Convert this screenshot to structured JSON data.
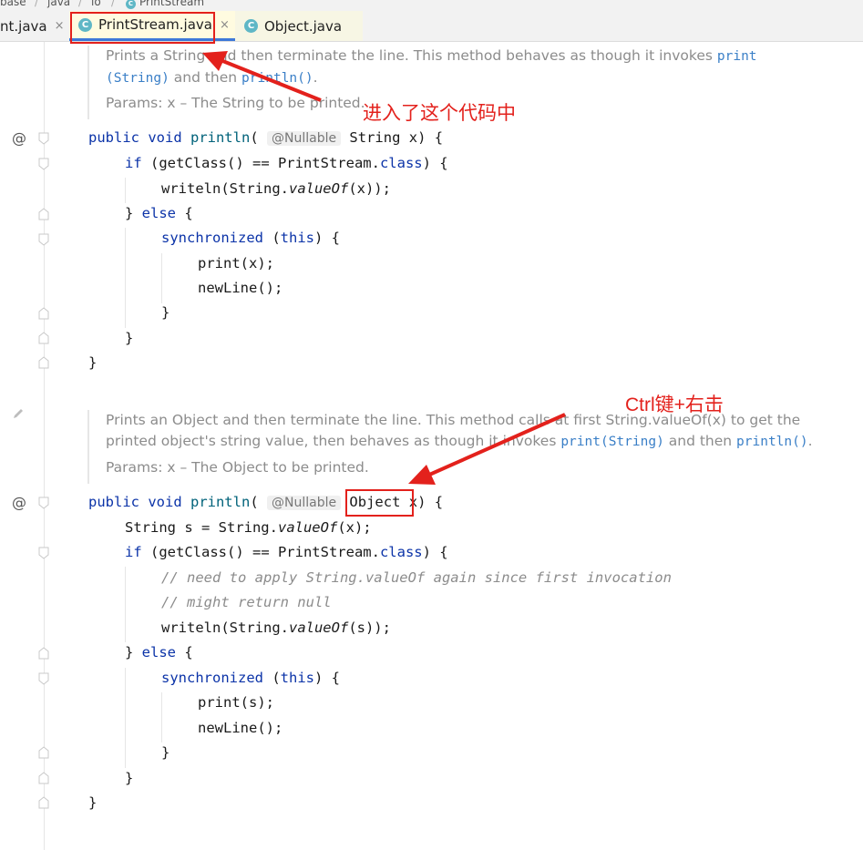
{
  "breadcrumb": {
    "items": [
      "base",
      "java",
      "io",
      "PrintStream"
    ]
  },
  "tabs": [
    {
      "label": "nt.java",
      "close": "×"
    },
    {
      "label": "PrintStream.java",
      "icon": "C",
      "close": "×"
    },
    {
      "label": "Object.java",
      "icon": "C"
    }
  ],
  "doc1": {
    "l1a": "Prints a String and then terminate the line. This method behaves as though it invokes ",
    "l1b": "print",
    "l2a": "(String)",
    "l2b": " and then ",
    "l2c": "println()",
    "l2d": ".",
    "p1": "Params: x – The ",
    "p2": "String",
    "p3": " to be printed."
  },
  "m1": {
    "l1a": "public void ",
    "l1b": "println",
    "l1c": "( ",
    "ann": "@Nullable",
    "l1d": " String x) {",
    "l2a": "if ",
    "l2b": "(getClass() == PrintStream.",
    "l2c": "class",
    "l2d": ") {",
    "l3a": "writeln(String.",
    "l3b": "valueOf",
    "l3c": "(x));",
    "l4a": "} ",
    "l4b": "else",
    "l4c": " {",
    "l5a": "synchronized",
    "l5b": " (",
    "l5c": "this",
    "l5d": ") {",
    "l6": "print(x);",
    "l7": "newLine();",
    "l8": "}",
    "l9": "}",
    "l10": "}"
  },
  "doc2": {
    "l1": "Prints an Object and then terminate the line. This method calls at first String.valueOf(x) to get the",
    "l2a": "printed object's string value, then behaves as though it invokes ",
    "l2b": "print(String)",
    "l2c": " and then ",
    "l2d": "println()",
    "l2e": ".",
    "p1": "Params: x – The ",
    "p2": "Object",
    "p3": " to be printed."
  },
  "m2": {
    "l1a": "public void ",
    "l1b": "println",
    "l1c": "( ",
    "ann": "@Nullable",
    "l1d": " Object",
    "l1e": " x) {",
    "l2a": "String s = String.",
    "l2b": "valueOf",
    "l2c": "(x);",
    "l3a": "if ",
    "l3b": "(getClass() == PrintStream.",
    "l3c": "class",
    "l3d": ") {",
    "l4": "// need to apply String.valueOf again since first invocation",
    "l5": "// might return null",
    "l6a": "writeln(String.",
    "l6b": "valueOf",
    "l6c": "(s));",
    "l7a": "} ",
    "l7b": "else",
    "l7c": " {",
    "l8a": "synchronized",
    "l8b": " (",
    "l8c": "this",
    "l8d": ") {",
    "l9": "print(s);",
    "l10": "newLine();",
    "l11": "}",
    "l12": "}",
    "l13": "}"
  },
  "gutter": {
    "at": "@"
  },
  "annotations": {
    "note1": "进入了这个代码中",
    "note2": "Ctrl键+右击",
    "color": "#e3211c"
  }
}
